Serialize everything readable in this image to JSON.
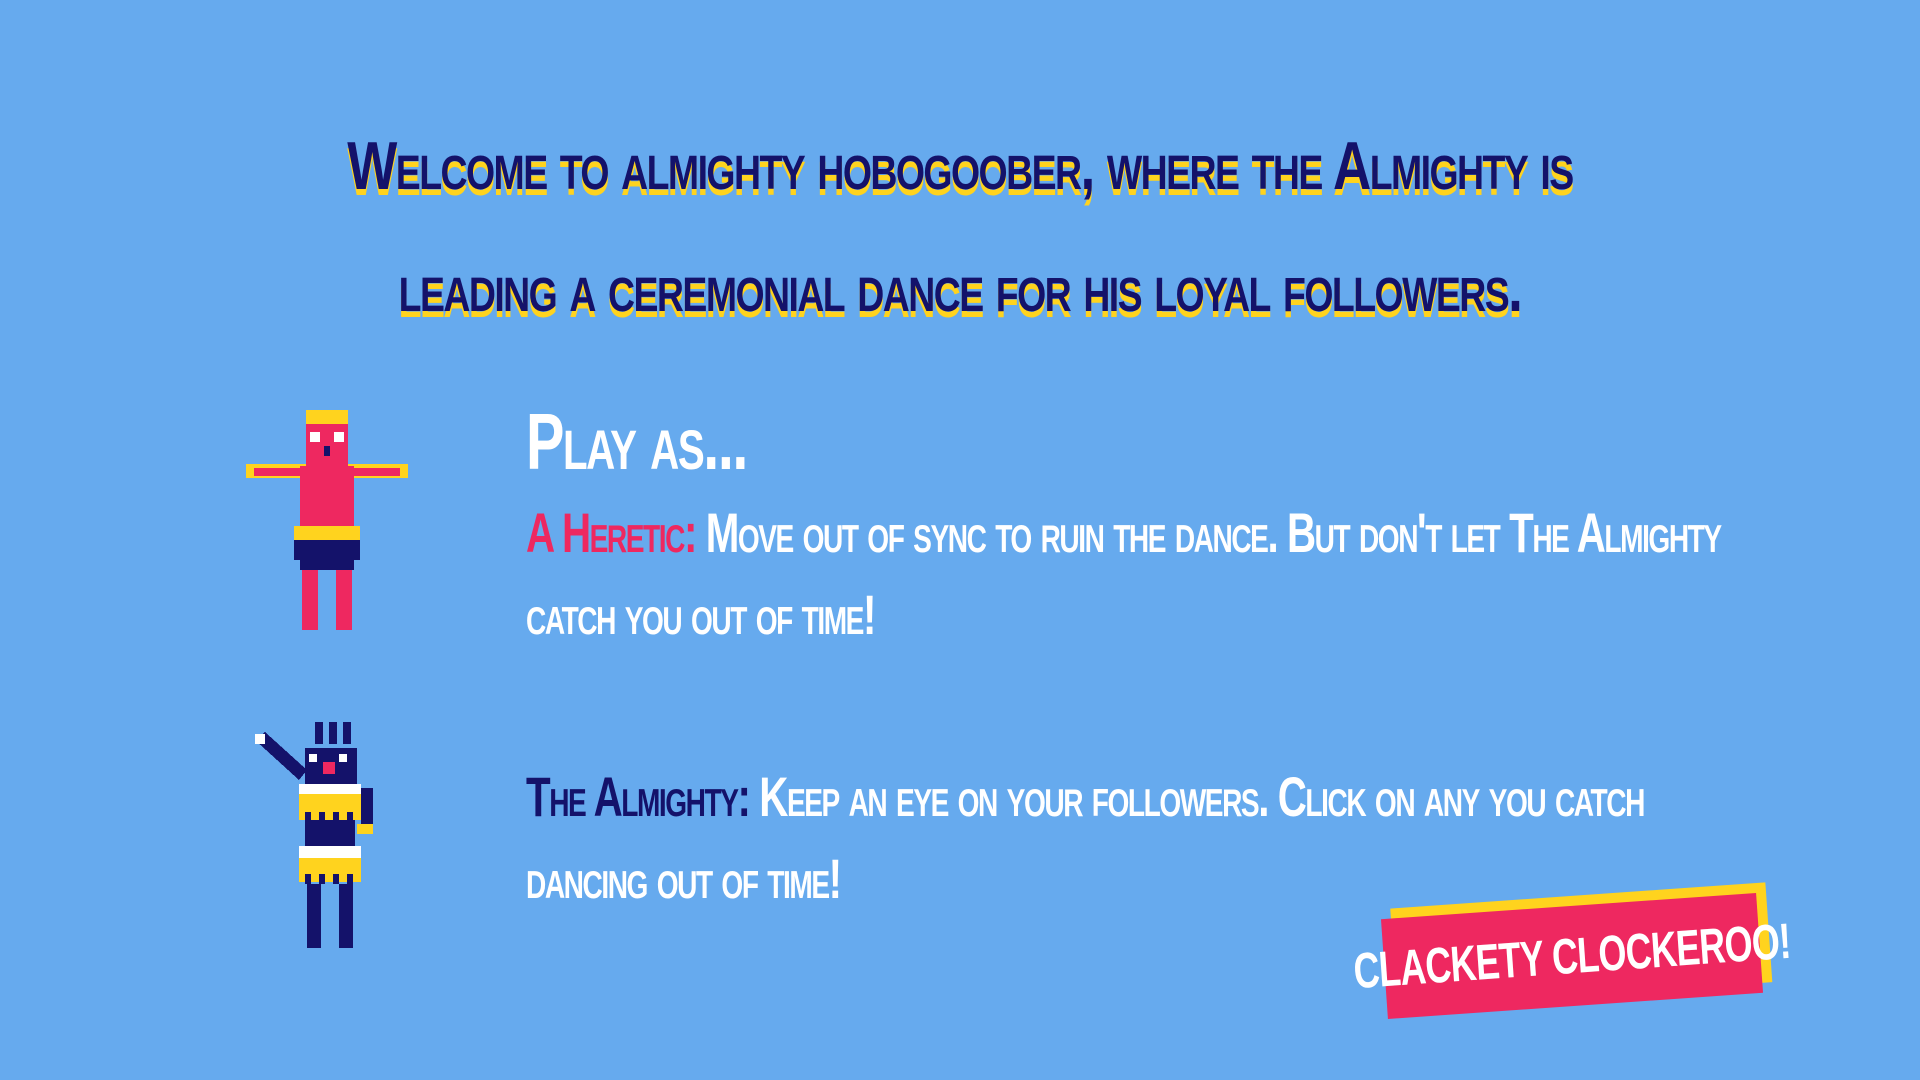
{
  "colors": {
    "background": "#66aaee",
    "navy": "#14126a",
    "yellow": "#ffd31e",
    "pink": "#ee2860",
    "white": "#ffffff"
  },
  "intro": {
    "headline": "Welcome to almighty hobogoober, where the Almighty is leading a ceremonial dance for his loyal followers."
  },
  "roles": {
    "title": "Play as...",
    "heretic": {
      "name": "A Heretic:",
      "description": "Move out of sync to ruin the dance. But don't let The Almighty catch you out of time!",
      "sprite_icon": "heretic-dancer-icon"
    },
    "almighty": {
      "name": "The Almighty:",
      "description": "Keep an eye on your followers. Click on any you catch dancing out of time!",
      "sprite_icon": "almighty-leader-icon"
    }
  },
  "start_button": {
    "label": "CLACKETY CLOCKEROO!"
  }
}
